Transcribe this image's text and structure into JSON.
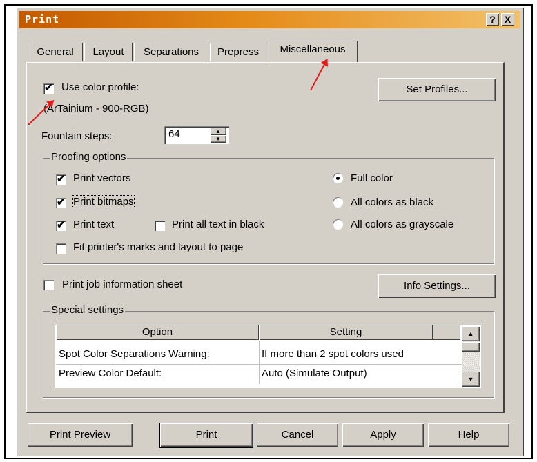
{
  "window": {
    "title": "Print",
    "help_button": "?",
    "close_button": "X"
  },
  "tabs": [
    {
      "label": "General"
    },
    {
      "label": "Layout"
    },
    {
      "label": "Separations"
    },
    {
      "label": "Prepress"
    },
    {
      "label": "Miscellaneous",
      "active": true
    }
  ],
  "color_profile": {
    "label": "Use color profile:",
    "checked": true,
    "profile_name": "(ArTainium - 900-RGB)",
    "set_profiles_button": "Set Profiles..."
  },
  "fountain": {
    "label": "Fountain steps:",
    "value": "64"
  },
  "proofing": {
    "group_label": "Proofing options",
    "checkboxes": [
      {
        "label": "Print vectors",
        "checked": true
      },
      {
        "label": "Print bitmaps",
        "checked": true
      },
      {
        "label": "Print text",
        "checked": true
      },
      {
        "label": "Print all text in black",
        "checked": false
      },
      {
        "label": "Fit printer's marks and layout to page",
        "checked": false
      }
    ],
    "radios": [
      {
        "label": "Full color",
        "selected": true
      },
      {
        "label": "All colors as black",
        "selected": false
      },
      {
        "label": "All colors as grayscale",
        "selected": false
      }
    ]
  },
  "job_info": {
    "label": "Print job information sheet",
    "checked": false,
    "info_settings_button": "Info Settings..."
  },
  "special": {
    "group_label": "Special settings",
    "columns": [
      "Option",
      "Setting"
    ],
    "rows": [
      {
        "option": "Spot Color Separations Warning:",
        "setting": "If more than 2 spot colors used"
      },
      {
        "option": "Preview Color Default:",
        "setting": "Auto (Simulate Output)"
      }
    ]
  },
  "footer": {
    "print_preview": "Print Preview",
    "print": "Print",
    "cancel": "Cancel",
    "apply": "Apply",
    "help": "Help"
  },
  "colors": {
    "title_gradient_start": "#c35a00",
    "title_gradient_end": "#f3c16a",
    "dialog_bg": "#d4d0c8",
    "annotation_arrow": "#e41b1b"
  }
}
